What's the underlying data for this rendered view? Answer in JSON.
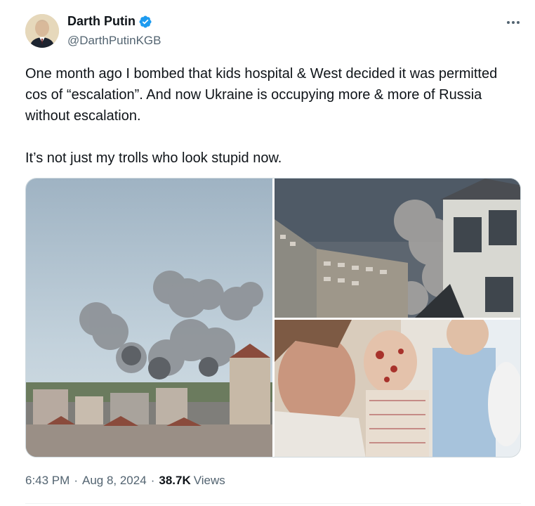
{
  "author": {
    "display_name": "Darth Putin",
    "handle": "@DarthPutinKGB",
    "verified": true,
    "verified_color": "#1d9bf0",
    "avatar_icon": "avatar-portrait"
  },
  "menu": {
    "icon": "more-horizontal-icon"
  },
  "tweet": {
    "paragraph_1": "One month ago I bombed that kids hospital & West decided it was permitted cos of “escalation”. And now Ukraine is occupying more & more of Russia without escalation.",
    "paragraph_2": "It’s not just my trolls who look stupid now."
  },
  "media": {
    "count": 3,
    "images": [
      {
        "icon": "photo-city-smoke"
      },
      {
        "icon": "photo-damaged-buildings"
      },
      {
        "icon": "photo-injured-child"
      }
    ]
  },
  "meta": {
    "time": "6:43 PM",
    "separator": "·",
    "date": "Aug 8, 2024",
    "views_count": "38.7K",
    "views_label": "Views"
  },
  "colors": {
    "text_primary": "#0f1419",
    "text_secondary": "#536471",
    "border": "#cfd9de"
  }
}
